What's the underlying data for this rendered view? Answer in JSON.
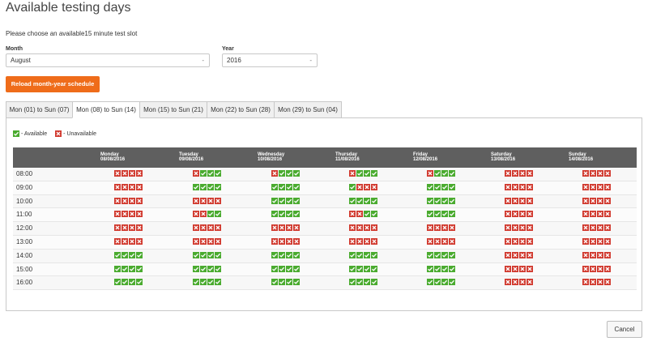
{
  "page": {
    "title": "Available testing days",
    "intro": "Please choose an available15 minute test slot"
  },
  "form": {
    "month_label": "Month",
    "month_value": "August",
    "year_label": "Year",
    "year_value": "2016",
    "reload_label": "Reload month-year schedule"
  },
  "tabs": [
    {
      "label": "Mon (01) to Sun (07)",
      "active": false
    },
    {
      "label": "Mon (08) to Sun (14)",
      "active": true
    },
    {
      "label": "Mon (15) to Sun (21)",
      "active": false
    },
    {
      "label": "Mon (22) to Sun (28)",
      "active": false
    },
    {
      "label": "Mon (29) to Sun (04)",
      "active": false
    }
  ],
  "legend": {
    "available": "- Available",
    "unavailable": "- Unavailable"
  },
  "colors": {
    "available": "#4aab2f",
    "unavailable": "#d13a2f",
    "accent": "#ef6c1a",
    "header": "#5f5f5f"
  },
  "schedule": {
    "days": [
      {
        "name": "Monday",
        "date": "08/08/2016"
      },
      {
        "name": "Tuesday",
        "date": "09/08/2016"
      },
      {
        "name": "Wednesday",
        "date": "10/08/2016"
      },
      {
        "name": "Thursday",
        "date": "11/08/2016"
      },
      {
        "name": "Friday",
        "date": "12/08/2016"
      },
      {
        "name": "Saturday",
        "date": "13/08/2016"
      },
      {
        "name": "Sunday",
        "date": "14/08/2016"
      }
    ],
    "rows": [
      {
        "time": "08:00",
        "slots": [
          "xxxx",
          "xvvv",
          "xvvv",
          "xvvv",
          "xvvv",
          "xxxx",
          "xxxx"
        ]
      },
      {
        "time": "09:00",
        "slots": [
          "xxxx",
          "vvvv",
          "vvvv",
          "vxxx",
          "vvvv",
          "xxxx",
          "xxxx"
        ]
      },
      {
        "time": "10:00",
        "slots": [
          "xxxx",
          "xxxx",
          "vvvv",
          "vvvv",
          "vvvv",
          "xxxx",
          "xxxx"
        ]
      },
      {
        "time": "11:00",
        "slots": [
          "xxxx",
          "xxvv",
          "vvvv",
          "xxvv",
          "vvvv",
          "xxxx",
          "xxxx"
        ]
      },
      {
        "time": "12:00",
        "slots": [
          "xxxx",
          "xxxx",
          "xxxx",
          "xxxx",
          "xxxx",
          "xxxx",
          "xxxx"
        ]
      },
      {
        "time": "13:00",
        "slots": [
          "xxxx",
          "xxxx",
          "xxxx",
          "xxxx",
          "xxxx",
          "xxxx",
          "xxxx"
        ]
      },
      {
        "time": "14:00",
        "slots": [
          "vvvv",
          "vvvv",
          "vvvv",
          "vvvv",
          "vvvv",
          "xxxx",
          "xxxx"
        ]
      },
      {
        "time": "15:00",
        "slots": [
          "vvvv",
          "vvvv",
          "vvvv",
          "vvvv",
          "vvvv",
          "xxxx",
          "xxxx"
        ]
      },
      {
        "time": "16:00",
        "slots": [
          "vvvv",
          "vvvv",
          "vvvv",
          "vvvv",
          "vvvv",
          "xxxx",
          "xxxx"
        ]
      }
    ]
  },
  "footer": {
    "cancel_label": "Cancel"
  }
}
